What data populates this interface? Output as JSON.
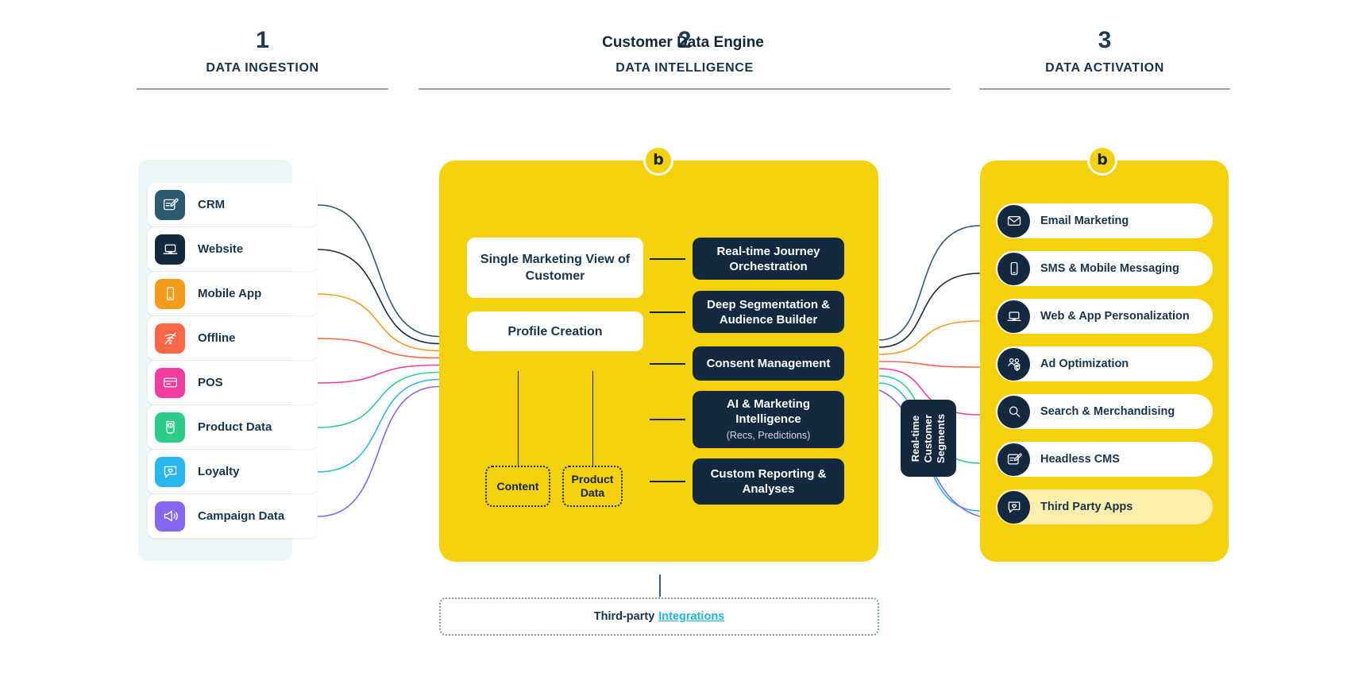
{
  "phases": [
    {
      "number": "1",
      "label": "DATA INGESTION"
    },
    {
      "number": "2",
      "label": "DATA INTELLIGENCE"
    },
    {
      "number": "3",
      "label": "DATA ACTIVATION"
    }
  ],
  "brand": {
    "logo_glyph": "b",
    "yellow": "#F5D10D",
    "dark": "#14293F",
    "link": "#22B5D6"
  },
  "ingestion": {
    "sources": [
      {
        "label": "CRM",
        "icon": "crm-edit-icon",
        "color": "#2B5A72"
      },
      {
        "label": "Website",
        "icon": "laptop-icon",
        "color": "#14293F"
      },
      {
        "label": "Mobile App",
        "icon": "mobile-phone-icon",
        "color": "#F59B1C"
      },
      {
        "label": "Offline",
        "icon": "no-signal-icon",
        "color": "#FA6647"
      },
      {
        "label": "POS",
        "icon": "card-terminal-icon",
        "color": "#F23C9E"
      },
      {
        "label": "Product Data",
        "icon": "product-info-icon",
        "color": "#2ECC8B"
      },
      {
        "label": "Loyalty",
        "icon": "heart-chat-icon",
        "color": "#29B6EC"
      },
      {
        "label": "Campaign Data",
        "icon": "megaphone-icon",
        "color": "#8466F0"
      }
    ]
  },
  "engine": {
    "title": "Customer Data Engine",
    "white_cards": [
      {
        "label": "Single Marketing View of Customer"
      },
      {
        "label": "Profile Creation"
      }
    ],
    "dotted_cards": [
      {
        "label": "Content"
      },
      {
        "label": "Product Data"
      }
    ],
    "capabilities": [
      {
        "label": "Real-time Journey Orchestration",
        "sub": ""
      },
      {
        "label": "Deep Segmentation & Audience Builder",
        "sub": ""
      },
      {
        "label": "Consent Management",
        "sub": ""
      },
      {
        "label": "AI & Marketing Intelligence",
        "sub": "(Recs, Predictions)"
      },
      {
        "label": "Custom Reporting & Analyses",
        "sub": ""
      }
    ]
  },
  "segments_chip": {
    "label": "Real-time Customer Segments"
  },
  "activation": {
    "channels": [
      {
        "label": "Email Marketing",
        "icon": "envelope-icon",
        "highlight": false
      },
      {
        "label": "SMS & Mobile Messaging",
        "icon": "mobile-phone-icon",
        "highlight": false
      },
      {
        "label": "Web & App Personalization",
        "icon": "laptop-icon",
        "highlight": false
      },
      {
        "label": "Ad Optimization",
        "icon": "audience-money-icon",
        "highlight": false
      },
      {
        "label": "Search & Merchandising",
        "icon": "magnifier-icon",
        "highlight": false
      },
      {
        "label": "Headless CMS",
        "icon": "crm-edit-icon",
        "highlight": false
      },
      {
        "label": "Third Party Apps",
        "icon": "heart-chat-icon",
        "highlight": true
      }
    ]
  },
  "footer": {
    "text": "Third-party",
    "link": "Integrations"
  },
  "wire_colors": [
    "#2B5A72",
    "#14293F",
    "#F59B1C",
    "#FA6647",
    "#F23C9E",
    "#2ECC8B",
    "#29B6EC",
    "#8466F0"
  ]
}
